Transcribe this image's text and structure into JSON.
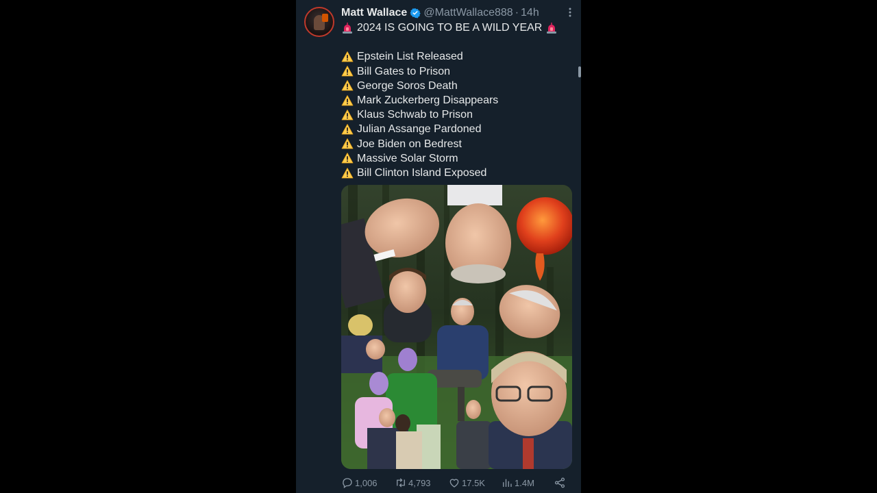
{
  "tweet": {
    "author_name": "Matt Wallace",
    "handle": "@MattWallace888",
    "separator": "·",
    "time": "14h",
    "headline": "2024 IS GOING TO BE A WILD YEAR",
    "items": [
      "Epstein List Released",
      "Bill Gates to Prison",
      "George Soros Death",
      "Mark Zuckerberg Disappears",
      "Klaus Schwab to Prison",
      "Julian Assange Pardoned",
      "Joe Biden on Bedrest",
      "Massive Solar Storm",
      "Bill Clinton Island Exposed"
    ],
    "stats": {
      "replies": "1,006",
      "reposts": "4,793",
      "likes": "17.5K",
      "views": "1.4M"
    }
  },
  "icons": {
    "verified": "verified-badge-icon",
    "siren": "siren-icon",
    "warning": "warning-icon",
    "more": "more-options-icon",
    "reply": "reply-icon",
    "repost": "repost-icon",
    "like": "like-icon",
    "views": "views-icon",
    "share": "share-icon"
  },
  "colors": {
    "background": "#15202b",
    "text": "#e7e9ea",
    "secondary": "#8b98a5",
    "verified": "#1d9bf0",
    "siren": "#e0245e",
    "warning": "#ffcc4d"
  }
}
